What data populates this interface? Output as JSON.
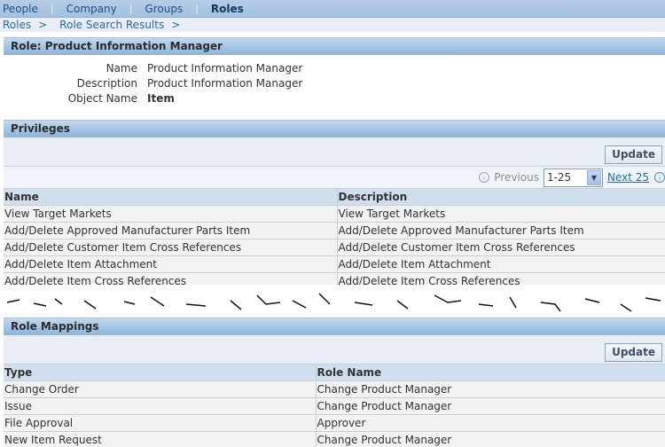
{
  "topnav": {
    "items": [
      {
        "label": "People",
        "active": false
      },
      {
        "label": "Company",
        "active": false
      },
      {
        "label": "Groups",
        "active": false
      },
      {
        "label": "Roles",
        "active": true
      }
    ],
    "separator": "|"
  },
  "breadcrumb": {
    "items": [
      "Roles",
      "Role Search Results"
    ],
    "separator": ">"
  },
  "role": {
    "header": "Role: Product Information Manager",
    "properties": [
      {
        "label": "Name",
        "value": "Product Information Manager",
        "bold": false
      },
      {
        "label": "Description",
        "value": "Product Information Manager",
        "bold": false
      },
      {
        "label": "Object Name",
        "value": "Item",
        "bold": true
      }
    ]
  },
  "privileges": {
    "header": "Privileges",
    "update_label": "Update",
    "pagination": {
      "previous_label": "Previous",
      "range_selected": "1-25",
      "next_label": "Next 25"
    },
    "columns": [
      "Name",
      "Description"
    ],
    "rows": [
      [
        "View Target Markets",
        "View Target Markets"
      ],
      [
        "Add/Delete Approved Manufacturer Parts Item",
        "Add/Delete Approved Manufacturer Parts Item"
      ],
      [
        "Add/Delete Customer Item Cross References",
        "Add/Delete Customer Item Cross References"
      ],
      [
        "Add/Delete Item Attachment",
        "Add/Delete Item Attachment"
      ],
      [
        "Add/Delete Item Cross References",
        "Add/Delete Item Cross References"
      ]
    ]
  },
  "role_mappings": {
    "header": "Role Mappings",
    "update_label": "Update",
    "columns": [
      "Type",
      "Role Name"
    ],
    "rows": [
      [
        "Change Order",
        "Change Product Manager"
      ],
      [
        "Issue",
        "Change Product Manager"
      ],
      [
        "File Approval",
        "Approver"
      ],
      [
        "New Item Request",
        "Change Product Manager"
      ]
    ]
  }
}
